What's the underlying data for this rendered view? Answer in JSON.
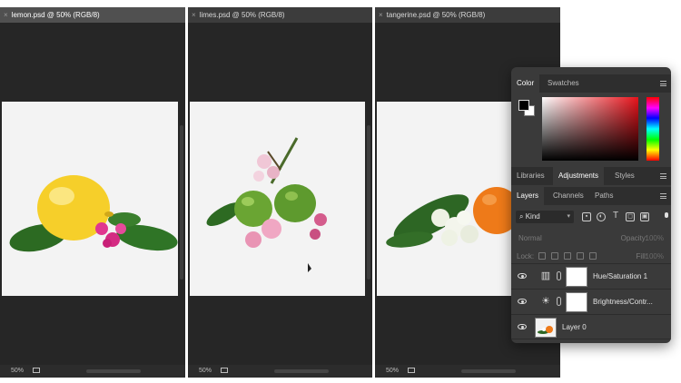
{
  "documents": [
    {
      "id": "lemon",
      "tab_label": "lemon.psd @ 50% (RGB/8)",
      "zoom": "50%"
    },
    {
      "id": "limes",
      "tab_label": "limes.psd @ 50% (RGB/8)",
      "zoom": "50%"
    },
    {
      "id": "tangerine",
      "tab_label": "tangerine.psd @ 50% (RGB/8)",
      "zoom": "50%"
    }
  ],
  "tab_close_glyph": "×",
  "color_panel": {
    "tabs": [
      "Color",
      "Swatches"
    ],
    "active_tab": "Color",
    "foreground": "#000000",
    "background": "#ffffff",
    "hue_color": "#e8131b"
  },
  "mid_tabs": [
    "Libraries",
    "Adjustments",
    "Styles"
  ],
  "mid_active": "Adjustments",
  "layers_panel": {
    "tabs": [
      "Layers",
      "Channels",
      "Paths"
    ],
    "active_tab": "Layers",
    "filter_kind": "Kind",
    "blend_mode": "Normal",
    "opacity_label": "Opacity:",
    "opacity_value": "100%",
    "lock_label": "Lock:",
    "fill_label": "Fill:",
    "fill_value": "100%",
    "layers": [
      {
        "name": "Hue/Saturation 1",
        "icon": "hue-saturation-icon",
        "visible": true
      },
      {
        "name": "Brightness/Contr...",
        "icon": "brightness-contrast-icon",
        "visible": true
      },
      {
        "name": "Layer 0",
        "icon": "layer-thumbnail",
        "visible": true
      }
    ]
  }
}
